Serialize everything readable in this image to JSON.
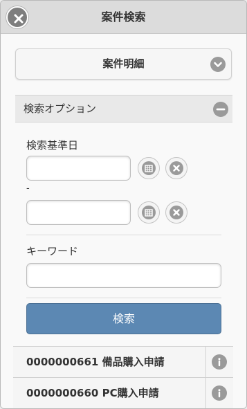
{
  "header": {
    "title": "案件検索",
    "close_icon": "close-icon"
  },
  "detail_button": {
    "label": "案件明細",
    "icon": "chevron-down-icon"
  },
  "options": {
    "label": "検索オプション",
    "icon": "minus-icon",
    "date_label": "検索基準日",
    "date_from": {
      "value": "",
      "placeholder": ""
    },
    "date_separator": "-",
    "date_to": {
      "value": "",
      "placeholder": ""
    },
    "keyword_label": "キーワード",
    "keyword": {
      "value": "",
      "placeholder": ""
    },
    "search_label": "検索"
  },
  "results": [
    {
      "label": "0000000661 備品購入申請"
    },
    {
      "label": "0000000660 PC購入申請"
    }
  ],
  "colors": {
    "accent": "#5c88b3",
    "header_bg": "#dcdcdc",
    "icon_gray": "#9a9a9a"
  }
}
